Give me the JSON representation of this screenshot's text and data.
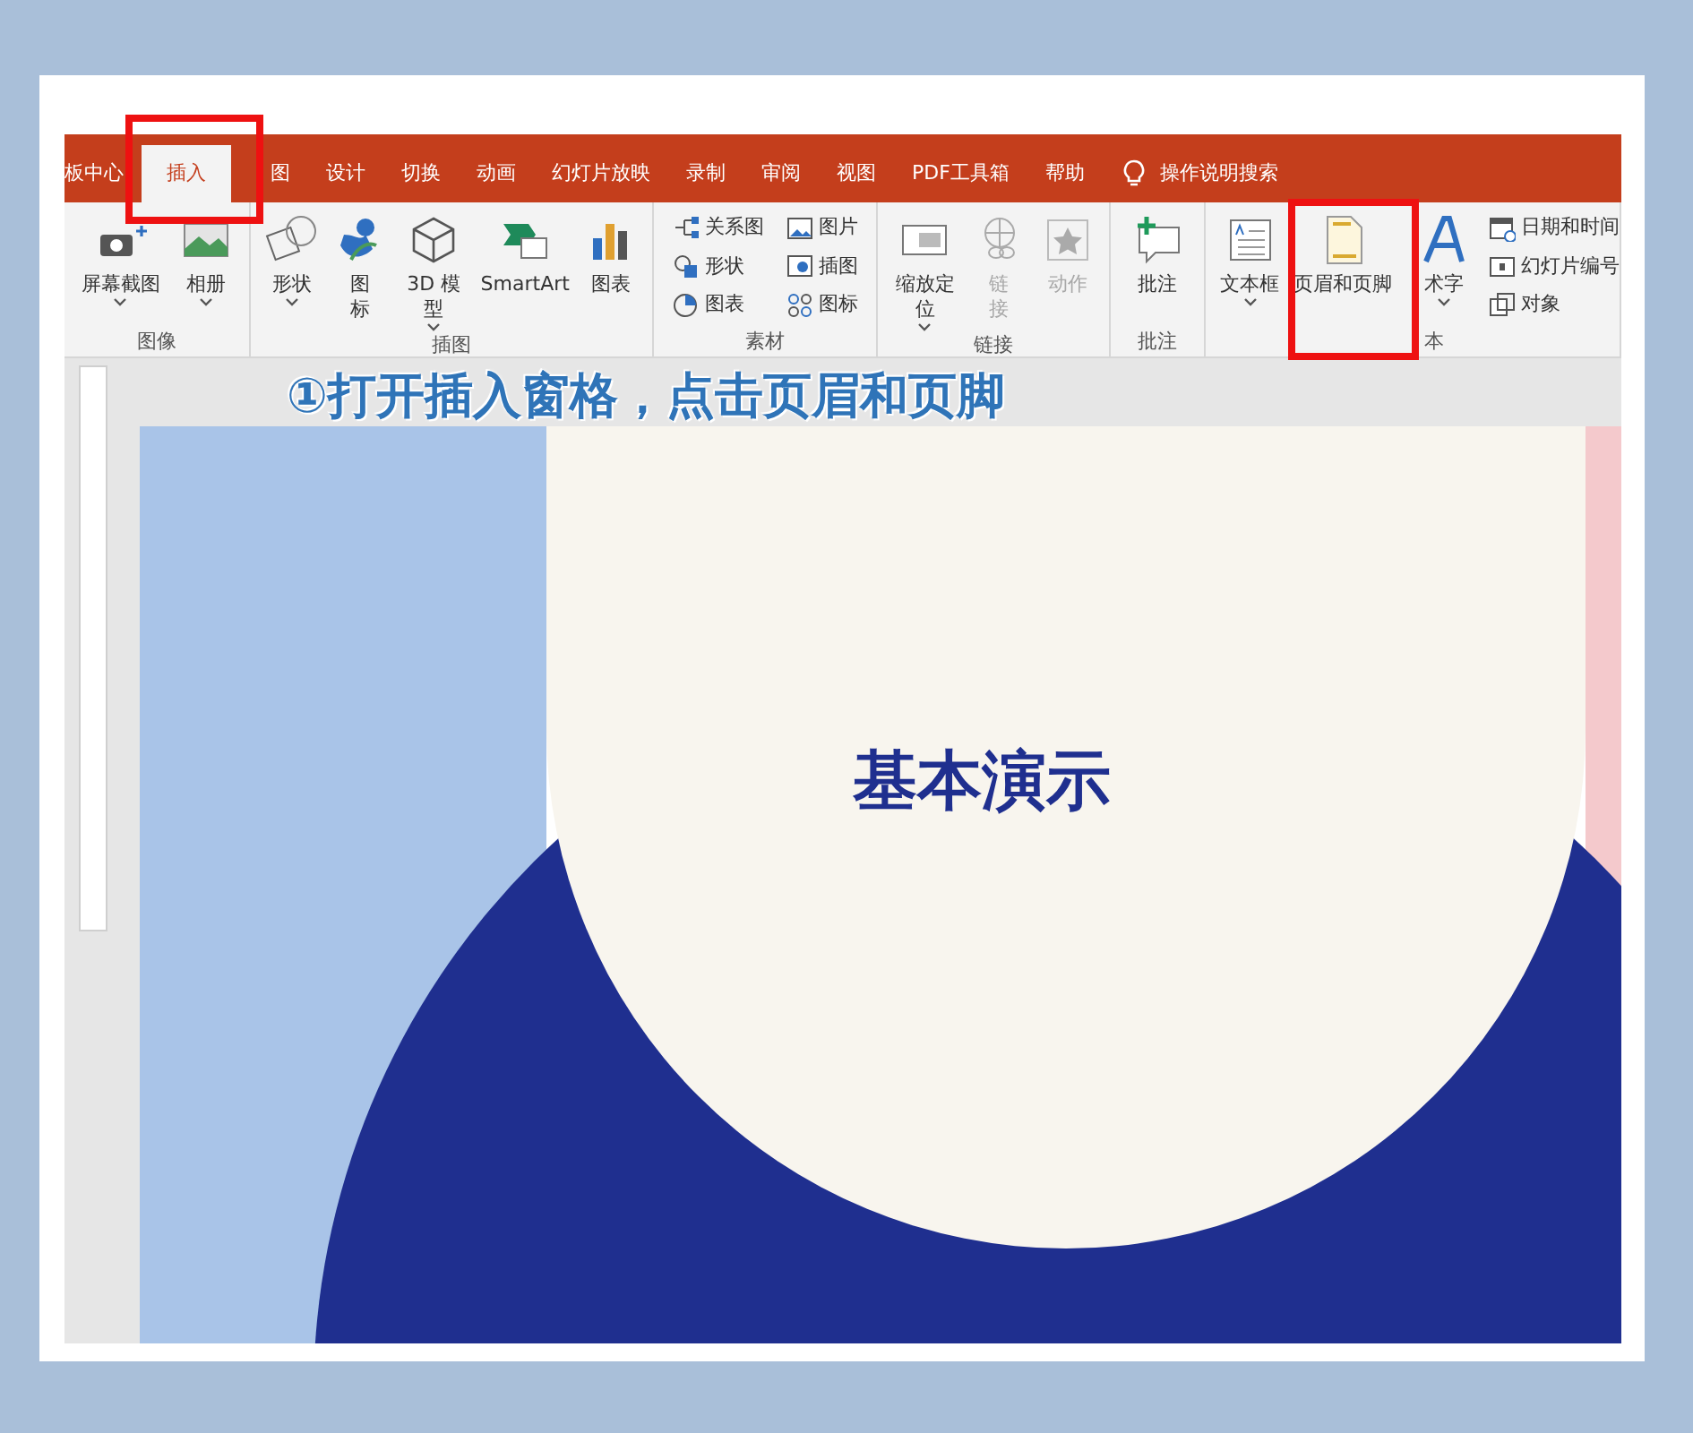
{
  "tabs": [
    {
      "label": "板中心",
      "selected": false
    },
    {
      "label": "插入",
      "selected": true
    },
    {
      "label": "图",
      "selected": false
    },
    {
      "label": "设计",
      "selected": false
    },
    {
      "label": "切换",
      "selected": false
    },
    {
      "label": "动画",
      "selected": false
    },
    {
      "label": "幻灯片放映",
      "selected": false
    },
    {
      "label": "录制",
      "selected": false
    },
    {
      "label": "审阅",
      "selected": false
    },
    {
      "label": "视图",
      "selected": false
    },
    {
      "label": "PDF工具箱",
      "selected": false
    },
    {
      "label": "帮助",
      "selected": false
    }
  ],
  "search": {
    "label": "操作说明搜索"
  },
  "groups": [
    {
      "label": "图像",
      "items": [
        {
          "kind": "large",
          "label": "屏幕截图",
          "dropdown": true,
          "disabled": false
        },
        {
          "kind": "large",
          "label": "相册",
          "dropdown": true,
          "disabled": false
        }
      ]
    },
    {
      "label": "插图",
      "items": [
        {
          "kind": "large",
          "label": "形状",
          "dropdown": true,
          "disabled": false
        },
        {
          "kind": "large",
          "label": "图标",
          "dropdown": false,
          "disabled": false
        },
        {
          "kind": "large",
          "label": "3D 模型",
          "dropdown": true,
          "disabled": false
        },
        {
          "kind": "large",
          "label": "SmartArt",
          "dropdown": false,
          "disabled": false
        },
        {
          "kind": "large",
          "label": "图表",
          "dropdown": false,
          "disabled": false
        }
      ]
    },
    {
      "label": "素材",
      "items": [
        {
          "kind": "small",
          "label": "关系图"
        },
        {
          "kind": "small",
          "label": "形状"
        },
        {
          "kind": "small",
          "label": "图表"
        },
        {
          "kind": "small",
          "label": "图片"
        },
        {
          "kind": "small",
          "label": "插图"
        },
        {
          "kind": "small",
          "label": "图标"
        }
      ]
    },
    {
      "label": "链接",
      "items": [
        {
          "kind": "large",
          "label": "缩放定位",
          "dropdown": true,
          "disabled": false
        },
        {
          "kind": "large",
          "label": "链接",
          "dropdown": false,
          "disabled": true
        },
        {
          "kind": "large",
          "label": "动作",
          "dropdown": false,
          "disabled": true
        }
      ]
    },
    {
      "label": "批注",
      "items": [
        {
          "kind": "large",
          "label": "批注",
          "dropdown": false,
          "disabled": false
        }
      ]
    },
    {
      "label": "本",
      "items": [
        {
          "kind": "large",
          "label": "文本框",
          "dropdown": true,
          "disabled": false
        },
        {
          "kind": "large",
          "label": "页眉和页脚",
          "dropdown": false,
          "disabled": false
        },
        {
          "kind": "large",
          "label": "术字",
          "dropdown": true,
          "disabled": false
        },
        {
          "kind": "small",
          "label": "日期和时间"
        },
        {
          "kind": "small",
          "label": "幻灯片编号"
        },
        {
          "kind": "small",
          "label": "对象"
        }
      ]
    }
  ],
  "caption": "①打开插入窗格，点击页眉和页脚",
  "slide": {
    "title": "基本演示"
  }
}
